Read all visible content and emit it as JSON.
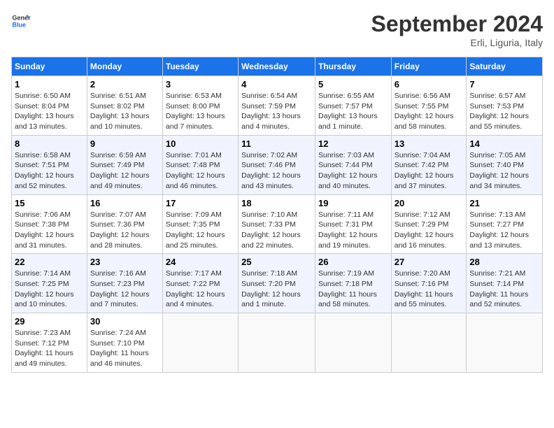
{
  "header": {
    "logo_line1": "General",
    "logo_line2": "Blue",
    "month": "September 2024",
    "location": "Erli, Liguria, Italy"
  },
  "days_of_week": [
    "Sunday",
    "Monday",
    "Tuesday",
    "Wednesday",
    "Thursday",
    "Friday",
    "Saturday"
  ],
  "weeks": [
    [
      {
        "day": "1",
        "lines": [
          "Sunrise: 6:50 AM",
          "Sunset: 8:04 PM",
          "Daylight: 13 hours",
          "and 13 minutes."
        ]
      },
      {
        "day": "2",
        "lines": [
          "Sunrise: 6:51 AM",
          "Sunset: 8:02 PM",
          "Daylight: 13 hours",
          "and 10 minutes."
        ]
      },
      {
        "day": "3",
        "lines": [
          "Sunrise: 6:53 AM",
          "Sunset: 8:00 PM",
          "Daylight: 13 hours",
          "and 7 minutes."
        ]
      },
      {
        "day": "4",
        "lines": [
          "Sunrise: 6:54 AM",
          "Sunset: 7:59 PM",
          "Daylight: 13 hours",
          "and 4 minutes."
        ]
      },
      {
        "day": "5",
        "lines": [
          "Sunrise: 6:55 AM",
          "Sunset: 7:57 PM",
          "Daylight: 13 hours",
          "and 1 minute."
        ]
      },
      {
        "day": "6",
        "lines": [
          "Sunrise: 6:56 AM",
          "Sunset: 7:55 PM",
          "Daylight: 12 hours",
          "and 58 minutes."
        ]
      },
      {
        "day": "7",
        "lines": [
          "Sunrise: 6:57 AM",
          "Sunset: 7:53 PM",
          "Daylight: 12 hours",
          "and 55 minutes."
        ]
      }
    ],
    [
      {
        "day": "8",
        "lines": [
          "Sunrise: 6:58 AM",
          "Sunset: 7:51 PM",
          "Daylight: 12 hours",
          "and 52 minutes."
        ]
      },
      {
        "day": "9",
        "lines": [
          "Sunrise: 6:59 AM",
          "Sunset: 7:49 PM",
          "Daylight: 12 hours",
          "and 49 minutes."
        ]
      },
      {
        "day": "10",
        "lines": [
          "Sunrise: 7:01 AM",
          "Sunset: 7:48 PM",
          "Daylight: 12 hours",
          "and 46 minutes."
        ]
      },
      {
        "day": "11",
        "lines": [
          "Sunrise: 7:02 AM",
          "Sunset: 7:46 PM",
          "Daylight: 12 hours",
          "and 43 minutes."
        ]
      },
      {
        "day": "12",
        "lines": [
          "Sunrise: 7:03 AM",
          "Sunset: 7:44 PM",
          "Daylight: 12 hours",
          "and 40 minutes."
        ]
      },
      {
        "day": "13",
        "lines": [
          "Sunrise: 7:04 AM",
          "Sunset: 7:42 PM",
          "Daylight: 12 hours",
          "and 37 minutes."
        ]
      },
      {
        "day": "14",
        "lines": [
          "Sunrise: 7:05 AM",
          "Sunset: 7:40 PM",
          "Daylight: 12 hours",
          "and 34 minutes."
        ]
      }
    ],
    [
      {
        "day": "15",
        "lines": [
          "Sunrise: 7:06 AM",
          "Sunset: 7:38 PM",
          "Daylight: 12 hours",
          "and 31 minutes."
        ]
      },
      {
        "day": "16",
        "lines": [
          "Sunrise: 7:07 AM",
          "Sunset: 7:36 PM",
          "Daylight: 12 hours",
          "and 28 minutes."
        ]
      },
      {
        "day": "17",
        "lines": [
          "Sunrise: 7:09 AM",
          "Sunset: 7:35 PM",
          "Daylight: 12 hours",
          "and 25 minutes."
        ]
      },
      {
        "day": "18",
        "lines": [
          "Sunrise: 7:10 AM",
          "Sunset: 7:33 PM",
          "Daylight: 12 hours",
          "and 22 minutes."
        ]
      },
      {
        "day": "19",
        "lines": [
          "Sunrise: 7:11 AM",
          "Sunset: 7:31 PM",
          "Daylight: 12 hours",
          "and 19 minutes."
        ]
      },
      {
        "day": "20",
        "lines": [
          "Sunrise: 7:12 AM",
          "Sunset: 7:29 PM",
          "Daylight: 12 hours",
          "and 16 minutes."
        ]
      },
      {
        "day": "21",
        "lines": [
          "Sunrise: 7:13 AM",
          "Sunset: 7:27 PM",
          "Daylight: 12 hours",
          "and 13 minutes."
        ]
      }
    ],
    [
      {
        "day": "22",
        "lines": [
          "Sunrise: 7:14 AM",
          "Sunset: 7:25 PM",
          "Daylight: 12 hours",
          "and 10 minutes."
        ]
      },
      {
        "day": "23",
        "lines": [
          "Sunrise: 7:16 AM",
          "Sunset: 7:23 PM",
          "Daylight: 12 hours",
          "and 7 minutes."
        ]
      },
      {
        "day": "24",
        "lines": [
          "Sunrise: 7:17 AM",
          "Sunset: 7:22 PM",
          "Daylight: 12 hours",
          "and 4 minutes."
        ]
      },
      {
        "day": "25",
        "lines": [
          "Sunrise: 7:18 AM",
          "Sunset: 7:20 PM",
          "Daylight: 12 hours",
          "and 1 minute."
        ]
      },
      {
        "day": "26",
        "lines": [
          "Sunrise: 7:19 AM",
          "Sunset: 7:18 PM",
          "Daylight: 11 hours",
          "and 58 minutes."
        ]
      },
      {
        "day": "27",
        "lines": [
          "Sunrise: 7:20 AM",
          "Sunset: 7:16 PM",
          "Daylight: 11 hours",
          "and 55 minutes."
        ]
      },
      {
        "day": "28",
        "lines": [
          "Sunrise: 7:21 AM",
          "Sunset: 7:14 PM",
          "Daylight: 11 hours",
          "and 52 minutes."
        ]
      }
    ],
    [
      {
        "day": "29",
        "lines": [
          "Sunrise: 7:23 AM",
          "Sunset: 7:12 PM",
          "Daylight: 11 hours",
          "and 49 minutes."
        ]
      },
      {
        "day": "30",
        "lines": [
          "Sunrise: 7:24 AM",
          "Sunset: 7:10 PM",
          "Daylight: 11 hours",
          "and 46 minutes."
        ]
      },
      null,
      null,
      null,
      null,
      null
    ]
  ]
}
